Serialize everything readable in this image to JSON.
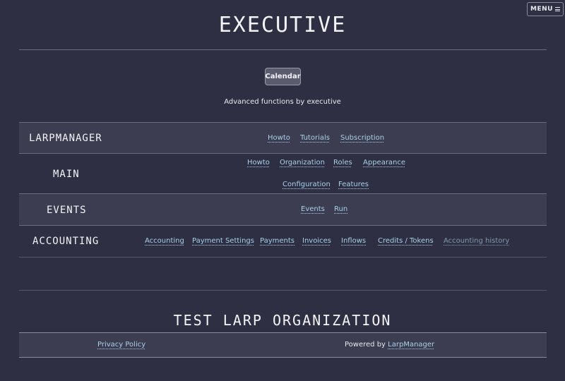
{
  "header": {
    "menu_label": "MENU",
    "menu_icon": "hamburger-icon",
    "title": "EXECUTIVE"
  },
  "toolbar": {
    "calendar_label": "Calendar"
  },
  "subtitle": "Advanced functions by executive",
  "sections": {
    "larpmanager": {
      "label": "LARPMANAGER",
      "links": [
        "Howto",
        "Tutorials",
        "Subscription"
      ]
    },
    "main": {
      "label": "MAIN",
      "links": [
        "Howto",
        "Organization",
        "Roles",
        "Appearance",
        "Configuration",
        "Features"
      ]
    },
    "events": {
      "label": "EVENTS",
      "links": [
        "Events",
        "Run"
      ]
    },
    "accounting": {
      "label": "ACCOUNTING",
      "links": [
        "Accounting",
        "Payment Settings",
        "Payments",
        "Invoices",
        "Inflows",
        "Credits / Tokens",
        "Accounting history"
      ]
    }
  },
  "organization": {
    "name": "TEST LARP ORGANIZATION"
  },
  "footer": {
    "privacy_label": "Privacy Policy",
    "powered_by_text": "Powered by",
    "powered_by_link": "LarpManager"
  },
  "colors": {
    "background": "#2e2f42",
    "band": "#3c3d50",
    "link": "#a8d0ea",
    "text": "#e8e8ee"
  }
}
